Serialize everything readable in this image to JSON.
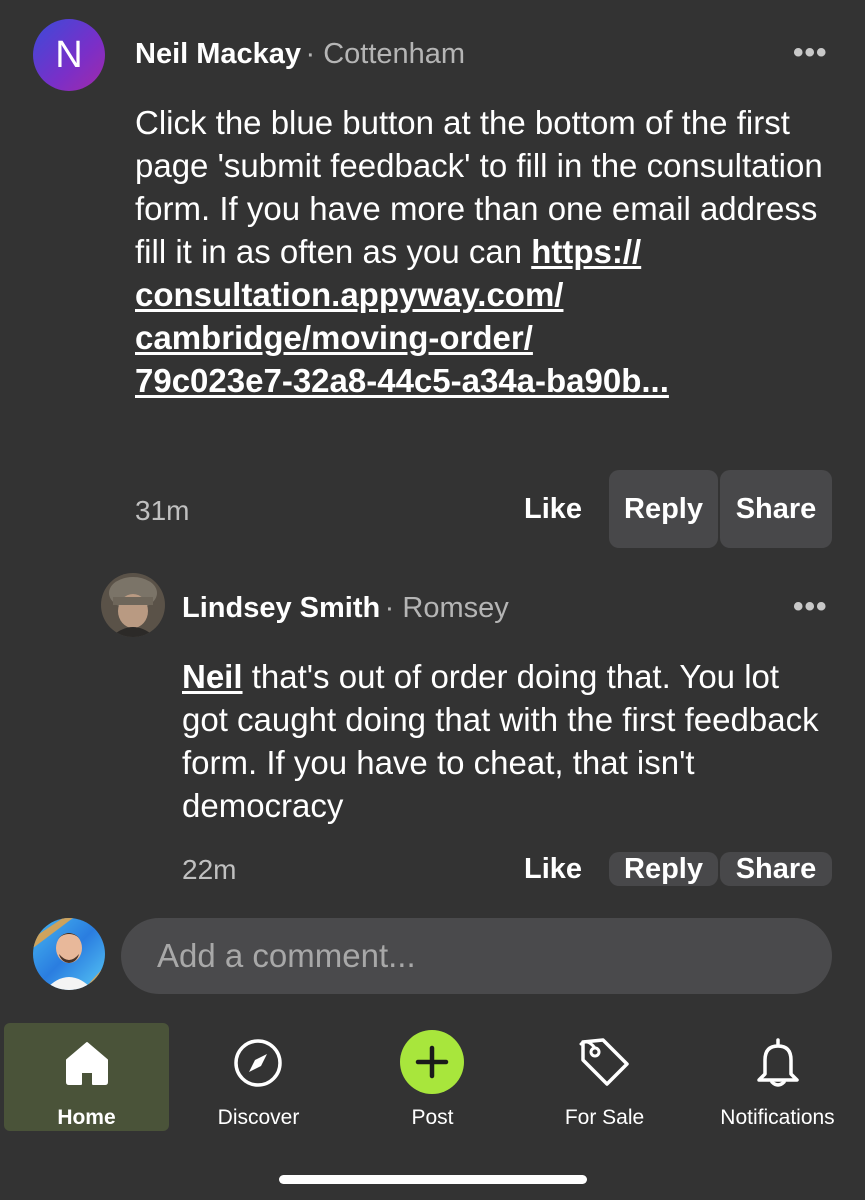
{
  "comment1": {
    "avatar_letter": "N",
    "author": "Neil Mackay",
    "location": "· Cottenham",
    "more": "•••",
    "text": "Click the blue button at the bottom of the first page 'submit feedback' to fill in the consultation form. If you have more than one email address fill it in as often as you can",
    "link_lines": [
      "https://",
      "consultation.appyway.com/",
      "cambridge/moving-order/",
      "79c023e7-32a8-44c5-a34a-ba90b..."
    ],
    "time": "31m",
    "like": "Like",
    "reply": "Reply",
    "share": "Share"
  },
  "comment2": {
    "author": "Lindsey Smith",
    "location": "· Romsey",
    "more": "•••",
    "mention": "Neil",
    "text": " that's out of order doing that. You lot got caught doing that with the first feedback form. If you have to cheat, that isn't democracy",
    "time": "22m",
    "like": "Like",
    "reply": "Reply",
    "share": "Share"
  },
  "composer": {
    "placeholder": "Add a comment..."
  },
  "nav": {
    "active_color": "#4a5339",
    "post_color": "#a8e63c",
    "items": [
      {
        "label": "Home",
        "icon": "home-icon"
      },
      {
        "label": "Discover",
        "icon": "compass-icon"
      },
      {
        "label": "Post",
        "icon": "plus-icon"
      },
      {
        "label": "For Sale",
        "icon": "tag-icon"
      },
      {
        "label": "Notifications",
        "icon": "bell-icon"
      }
    ]
  }
}
